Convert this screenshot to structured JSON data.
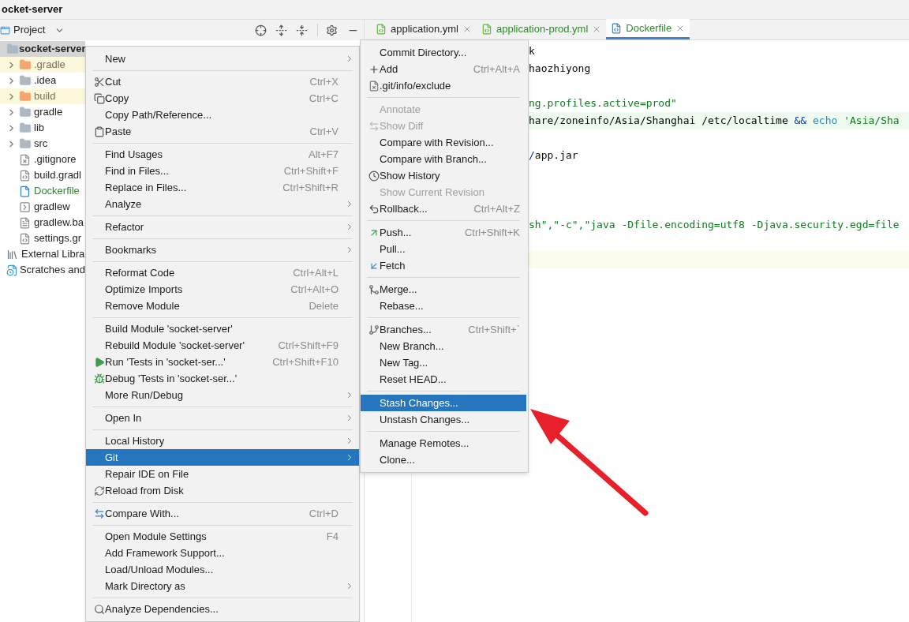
{
  "title": "ocket-server",
  "project_panel": {
    "label": "Project"
  },
  "tree": [
    {
      "label": "socket-server",
      "kind": "root",
      "selected": true,
      "excluded": false,
      "added": false,
      "children": [
        {
          "label": ".gradle",
          "kind": "folder",
          "expanded": false,
          "selected": false,
          "excluded": true,
          "added": false
        },
        {
          "label": ".idea",
          "kind": "folder",
          "expanded": false,
          "selected": false,
          "excluded": false,
          "added": false
        },
        {
          "label": "build",
          "kind": "folder",
          "expanded": false,
          "selected": false,
          "excluded": true,
          "added": false
        },
        {
          "label": "gradle",
          "kind": "folder",
          "expanded": false,
          "selected": false,
          "excluded": false,
          "added": false
        },
        {
          "label": "lib",
          "kind": "folder",
          "expanded": false,
          "selected": false,
          "excluded": false,
          "added": false
        },
        {
          "label": "src",
          "kind": "folder",
          "expanded": false,
          "selected": false,
          "excluded": false,
          "added": false
        },
        {
          "label": ".gitignore",
          "kind": "file",
          "selected": false,
          "excluded": false,
          "added": false
        },
        {
          "label": "build.gradl",
          "kind": "file",
          "selected": false,
          "excluded": false,
          "added": false
        },
        {
          "label": "Dockerfile",
          "kind": "file",
          "selected": false,
          "excluded": false,
          "added": true
        },
        {
          "label": "gradlew",
          "kind": "file",
          "selected": false,
          "excluded": false,
          "added": false
        },
        {
          "label": "gradlew.ba",
          "kind": "file",
          "selected": false,
          "excluded": false,
          "added": false
        },
        {
          "label": "settings.gr",
          "kind": "file",
          "selected": false,
          "excluded": false,
          "added": false
        }
      ]
    },
    {
      "label": "External Libra",
      "kind": "libraries",
      "selected": false,
      "excluded": false,
      "added": false
    },
    {
      "label": "Scratches and",
      "kind": "scratches",
      "selected": false,
      "excluded": false,
      "added": false
    }
  ],
  "tabs": [
    {
      "label": "application.yml",
      "changed": false,
      "selected": false
    },
    {
      "label": "application-prod.yml",
      "changed": true,
      "selected": false
    },
    {
      "label": "Dockerfile",
      "changed": true,
      "selected": true
    }
  ],
  "editor": {
    "lines": [
      {
        "kind": "plain",
        "segments": [
          {
            "text": "k",
            "kind": "plain"
          }
        ]
      },
      {
        "kind": "plain",
        "segments": [
          {
            "text": "haozhiyong",
            "kind": "plain"
          }
        ]
      },
      {
        "kind": "plain"
      },
      {
        "kind": "plain",
        "segments": [
          {
            "text": "ng.profiles.active=prod\"",
            "kind": "string"
          }
        ]
      },
      {
        "kind": "changed",
        "segments": [
          {
            "text": "hare/zoneinfo/Asia/Shanghai /etc/localtime ",
            "kind": "plain"
          },
          {
            "text": "&& ",
            "kind": "operator"
          },
          {
            "text": "echo",
            "kind": "keyword"
          },
          {
            "text": " 'Asia/Sha",
            "kind": "string"
          }
        ]
      },
      {
        "kind": "plain"
      },
      {
        "kind": "plain",
        "segments": [
          {
            "text": "/",
            "kind": "operator"
          },
          {
            "text": "app.jar",
            "kind": "plain"
          }
        ]
      },
      {
        "kind": "plain"
      },
      {
        "kind": "plain"
      },
      {
        "kind": "plain"
      },
      {
        "kind": "plain",
        "segments": [
          {
            "text": "sh\",\"-c\",\"java -Dfile.encoding=utf8 -Djava.security.egd=file",
            "kind": "string"
          }
        ]
      },
      {
        "kind": "plain"
      },
      {
        "kind": "caret"
      }
    ]
  },
  "context_menu": {
    "groups": [
      [
        {
          "label": "New",
          "submenu": true,
          "selected": false
        }
      ],
      [
        {
          "label": "Cut",
          "shortcut": "Ctrl+X",
          "submenu": false,
          "selected": false
        },
        {
          "label": "Copy",
          "shortcut": "Ctrl+C",
          "submenu": false,
          "selected": false
        },
        {
          "label": "Copy Path/Reference...",
          "submenu": false,
          "selected": false
        },
        {
          "label": "Paste",
          "shortcut": "Ctrl+V",
          "submenu": false,
          "selected": false
        }
      ],
      [
        {
          "label": "Find Usages",
          "shortcut": "Alt+F7",
          "submenu": false,
          "selected": false
        },
        {
          "label": "Find in Files...",
          "shortcut": "Ctrl+Shift+F",
          "submenu": false,
          "selected": false
        },
        {
          "label": "Replace in Files...",
          "shortcut": "Ctrl+Shift+R",
          "submenu": false,
          "selected": false
        },
        {
          "label": "Analyze",
          "submenu": true,
          "selected": false
        }
      ],
      [
        {
          "label": "Refactor",
          "submenu": true,
          "selected": false
        }
      ],
      [
        {
          "label": "Bookmarks",
          "submenu": true,
          "selected": false
        }
      ],
      [
        {
          "label": "Reformat Code",
          "shortcut": "Ctrl+Alt+L",
          "submenu": false,
          "selected": false
        },
        {
          "label": "Optimize Imports",
          "shortcut": "Ctrl+Alt+O",
          "submenu": false,
          "selected": false
        },
        {
          "label": "Remove Module",
          "shortcut": "Delete",
          "submenu": false,
          "selected": false
        }
      ],
      [
        {
          "label": "Build Module 'socket-server'",
          "submenu": false,
          "selected": false
        },
        {
          "label": "Rebuild Module 'socket-server'",
          "shortcut": "Ctrl+Shift+F9",
          "submenu": false,
          "selected": false
        },
        {
          "label": "Run 'Tests in 'socket-ser...'",
          "shortcut": "Ctrl+Shift+F10",
          "submenu": false,
          "selected": false
        },
        {
          "label": "Debug 'Tests in 'socket-ser...'",
          "submenu": false,
          "selected": false
        },
        {
          "label": "More Run/Debug",
          "submenu": true,
          "selected": false
        }
      ],
      [
        {
          "label": "Open In",
          "submenu": true,
          "selected": false
        }
      ],
      [
        {
          "label": "Local History",
          "submenu": true,
          "selected": false
        },
        {
          "label": "Git",
          "submenu": true,
          "selected": true
        },
        {
          "label": "Repair IDE on File",
          "submenu": false,
          "selected": false
        },
        {
          "label": "Reload from Disk",
          "submenu": false,
          "selected": false
        }
      ],
      [
        {
          "label": "Compare With...",
          "shortcut": "Ctrl+D",
          "submenu": false,
          "selected": false
        }
      ],
      [
        {
          "label": "Open Module Settings",
          "shortcut": "F4",
          "submenu": false,
          "selected": false
        },
        {
          "label": "Add Framework Support...",
          "submenu": false,
          "selected": false
        },
        {
          "label": "Load/Unload Modules...",
          "submenu": false,
          "selected": false
        },
        {
          "label": "Mark Directory as",
          "submenu": true,
          "selected": false
        }
      ],
      [
        {
          "label": "Analyze Dependencies...",
          "submenu": false,
          "selected": false
        }
      ]
    ]
  },
  "git_menu": {
    "groups": [
      [
        {
          "label": "Commit Directory...",
          "disabled": false,
          "selected": false
        },
        {
          "label": "Add",
          "shortcut": "Ctrl+Alt+A",
          "disabled": false,
          "selected": false
        },
        {
          "label": ".git/info/exclude",
          "disabled": false,
          "selected": false
        }
      ],
      [
        {
          "label": "Annotate",
          "disabled": true,
          "selected": false
        },
        {
          "label": "Show Diff",
          "disabled": true,
          "selected": false
        },
        {
          "label": "Compare with Revision...",
          "disabled": false,
          "selected": false
        },
        {
          "label": "Compare with Branch...",
          "disabled": false,
          "selected": false
        },
        {
          "label": "Show History",
          "disabled": false,
          "selected": false
        },
        {
          "label": "Show Current Revision",
          "disabled": true,
          "selected": false
        },
        {
          "label": "Rollback...",
          "shortcut": "Ctrl+Alt+Z",
          "disabled": false,
          "selected": false
        }
      ],
      [
        {
          "label": "Push...",
          "shortcut": "Ctrl+Shift+K",
          "disabled": false,
          "selected": false
        },
        {
          "label": "Pull...",
          "disabled": false,
          "selected": false
        },
        {
          "label": "Fetch",
          "disabled": false,
          "selected": false
        }
      ],
      [
        {
          "label": "Merge...",
          "disabled": false,
          "selected": false
        },
        {
          "label": "Rebase...",
          "disabled": false,
          "selected": false
        }
      ],
      [
        {
          "label": "Branches...",
          "shortcut": "Ctrl+Shift+`",
          "disabled": false,
          "selected": false
        },
        {
          "label": "New Branch...",
          "disabled": false,
          "selected": false
        },
        {
          "label": "New Tag...",
          "disabled": false,
          "selected": false
        },
        {
          "label": "Reset HEAD...",
          "disabled": false,
          "selected": false
        }
      ],
      [
        {
          "label": "Stash Changes...",
          "disabled": false,
          "selected": true
        },
        {
          "label": "Unstash Changes...",
          "disabled": false,
          "selected": false
        }
      ],
      [
        {
          "label": "Manage Remotes...",
          "disabled": false,
          "selected": false
        },
        {
          "label": "Clone...",
          "disabled": false,
          "selected": false
        }
      ]
    ]
  }
}
